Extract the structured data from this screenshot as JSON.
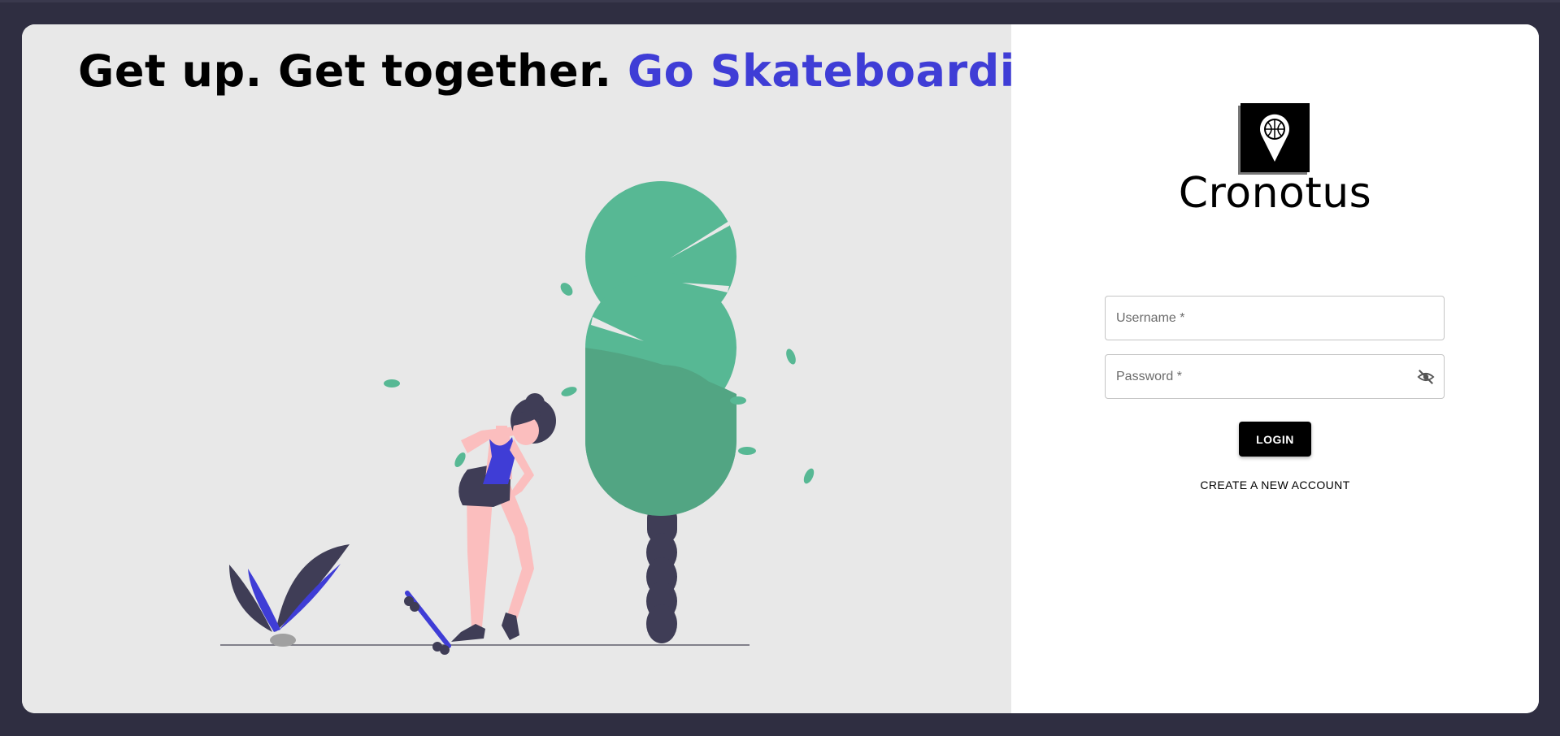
{
  "headline": {
    "part1": "Get up. Get together. ",
    "part2": "Go Skateboarding!"
  },
  "colors": {
    "accent": "#3f3dd6",
    "tree": "#57b894",
    "dark": "#3f3d56",
    "skin": "#fbbebe",
    "background": "#2f2e41"
  },
  "illustration": {
    "figure": "skater-girl",
    "icons": [
      "tree",
      "plant",
      "skateboard",
      "leaves"
    ]
  },
  "login": {
    "logo_icon": "map-pin-basketball-icon",
    "brand": "Cronotus",
    "username_placeholder": "Username *",
    "password_placeholder": "Password *",
    "password_toggle_icon": "eye-off-icon",
    "login_label": "LOGIN",
    "create_account_label": "CREATE A NEW ACCOUNT"
  }
}
